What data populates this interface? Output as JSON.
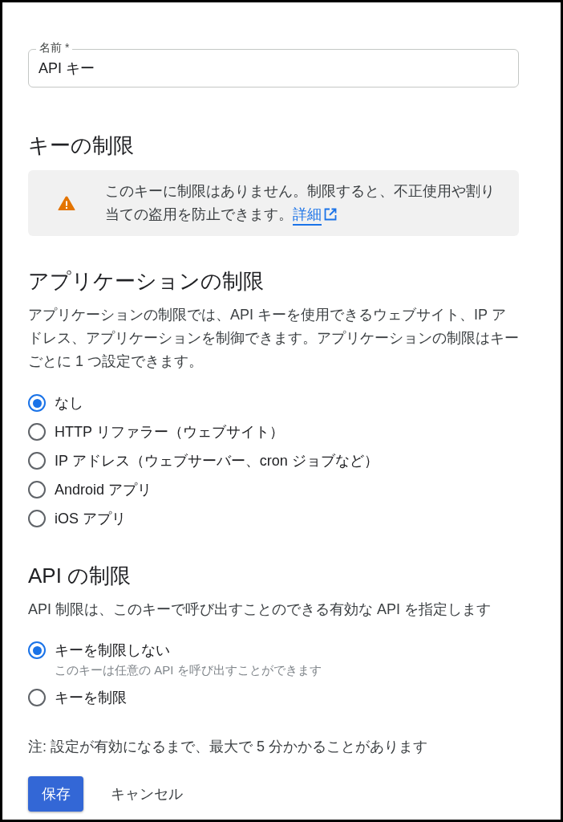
{
  "name_field": {
    "label": "名前 *",
    "value": "API キー"
  },
  "key_restrictions": {
    "heading": "キーの制限",
    "notice": {
      "text": "このキーに制限はありません。制限すると、不正使用や割り当ての盗用を防止できます。",
      "link": "詳細"
    }
  },
  "application_restrictions": {
    "heading": "アプリケーションの制限",
    "description": "アプリケーションの制限では、API キーを使用できるウェブサイト、IP アドレス、アプリケーションを制御できます。アプリケーションの制限はキーごとに 1 つ設定できます。",
    "options": [
      {
        "label": "なし",
        "selected": true
      },
      {
        "label": "HTTP リファラー（ウェブサイト）",
        "selected": false
      },
      {
        "label": "IP アドレス（ウェブサーバー、cron ジョブなど）",
        "selected": false
      },
      {
        "label": "Android アプリ",
        "selected": false
      },
      {
        "label": "iOS アプリ",
        "selected": false
      }
    ]
  },
  "api_restrictions": {
    "heading": "API の制限",
    "description": "API 制限は、このキーで呼び出すことのできる有効な API を指定します",
    "options": [
      {
        "label": "キーを制限しない",
        "hint": "このキーは任意の API を呼び出すことができます",
        "selected": true
      },
      {
        "label": "キーを制限",
        "selected": false
      }
    ]
  },
  "note": "注: 設定が有効になるまで、最大で 5 分かかることがあります",
  "buttons": [
    {
      "label": "保存",
      "kind": "primary"
    },
    {
      "label": "キャンセル",
      "kind": "text"
    }
  ]
}
